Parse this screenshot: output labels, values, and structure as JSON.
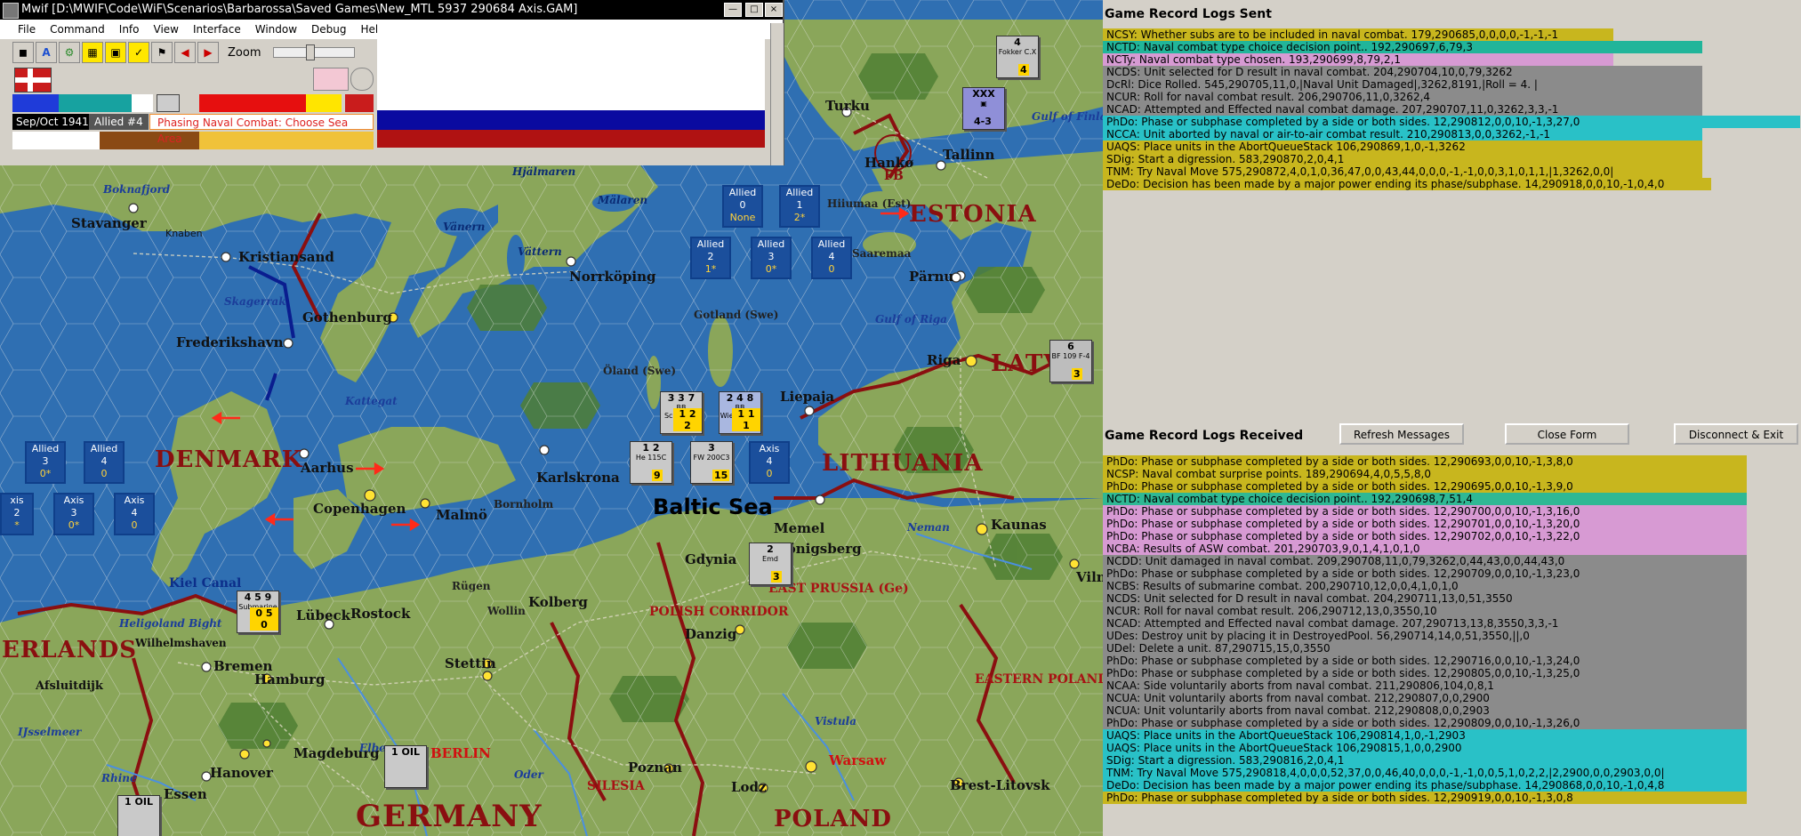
{
  "window": {
    "title": "Mwif [D:\\MWIF\\Code\\WiF\\Scenarios\\Barbarossa\\Saved Games\\New_MTL 5937 290684 Axis.GAM]",
    "menu": [
      "File",
      "Command",
      "Info",
      "View",
      "Interface",
      "Window",
      "Debug",
      "Help"
    ],
    "zoom_label": "Zoom",
    "zoom_value": "4",
    "date": "Sep/Oct 1941",
    "side_turn": "Allied #4",
    "phase": "Phasing Naval Combat: Choose Sea Area"
  },
  "map": {
    "countries": [
      "ESTONIA",
      "DENMARK",
      "LITHUANIA",
      "GERMANY",
      "POLAND",
      "LATV",
      "ERLANDS"
    ],
    "regions": [
      "EAST PRUSSIA (Ge)",
      "POLISH CORRIDOR",
      "EASTERN POLAND",
      "SILESIA"
    ],
    "cities": [
      "Turku",
      "Hankø",
      "Tallinn",
      "Pärnu",
      "Riga",
      "Stavanger",
      "Kristiansand",
      "Gothenburg",
      "Frederikshavn",
      "Aarhus",
      "Copenhagen",
      "Malmö",
      "Karlskrona",
      "Norrköping",
      "Liepaja",
      "Memel",
      "Kaunas",
      "Gdynia",
      "Königsberg",
      "Danzig",
      "Lübeck",
      "Rostock",
      "Kolberg",
      "Stettin",
      "Bremen",
      "Hamburg",
      "Hanover",
      "Magdeburg",
      "BERLIN",
      "Poznan",
      "Lodz",
      "Warsaw",
      "Brest-Litovsk",
      "Essen",
      "Wilhelmshaven",
      "Afsluitdijk",
      "Vilnius",
      "Kiel Canal"
    ],
    "seas": [
      "Boknafjord",
      "Skagerrak",
      "Kattegat",
      "Vänern",
      "Vättern",
      "Mälaren",
      "Hjälmaren",
      "Gotland (Swe)",
      "Öland (Swe)",
      "Bornholm",
      "Rügen",
      "Wollin",
      "Gulf of Riga",
      "Gulf of Finla",
      "Hiiumaa (Est)",
      "Saaremaa",
      "Heligoland Bight",
      "IJsselmeer",
      "Elbe",
      "Oder",
      "Vistula",
      "Neman",
      "Rhine",
      "Knaben"
    ],
    "sea_name": "Baltic Sea",
    "fb_label": "FB",
    "stacks": [
      {
        "side": "Allied",
        "num": "0",
        "val": "None"
      },
      {
        "side": "Allied",
        "num": "1",
        "val": "2*"
      },
      {
        "side": "Allied",
        "num": "2",
        "val": "1*"
      },
      {
        "side": "Allied",
        "num": "3",
        "val": "0*"
      },
      {
        "side": "Allied",
        "num": "4",
        "val": "0"
      },
      {
        "side": "Allied",
        "num": "3",
        "val": "0*"
      },
      {
        "side": "Allied",
        "num": "4",
        "val": "0"
      },
      {
        "side": "Axis",
        "num": "4",
        "val": "0"
      },
      {
        "side": "Axis",
        "num": "3",
        "val": "0*"
      },
      {
        "side": "Axis",
        "num": "4",
        "val": "0"
      },
      {
        "side": "xis",
        "num": "2",
        "val": "*"
      }
    ],
    "units": [
      "BB Schlesien",
      "BB Wiesentien",
      "He 115C",
      "FW 200C3",
      "Submarine",
      "Emd",
      "BF 109 F-4",
      "Fokker C.X",
      "1 OIL",
      "1 OIL"
    ]
  },
  "sent": {
    "title": "Game Record Logs Sent",
    "lines": [
      {
        "text": "NCSY: Whether subs are to be included in naval combat. 179,290685,0,0,0,0,-1,-1,-1",
        "color": "olive"
      },
      {
        "text": "NCTD: Naval combat type choice decision point.. 192,290697,6,79,3",
        "color": "teal"
      },
      {
        "text": "NCTy: Naval combat type chosen. 193,290699,8,79,2,1",
        "color": "pink"
      },
      {
        "text": "NCDS: Unit selected for D result in naval combat. 204,290704,10,0,79,3262",
        "color": "gray"
      },
      {
        "text": "DcRl: Dice Rolled. 545,290705,11,0,|Naval Unit Damaged|,3262,8191,|Roll = 4. |",
        "color": "gray"
      },
      {
        "text": "NCUR: Roll for naval combat result. 206,290706,11,0,3262,4",
        "color": "gray"
      },
      {
        "text": "NCAD: Attempted and Effected naval combat damage. 207,290707,11,0,3262,3,3,-1",
        "color": "gray"
      },
      {
        "text": "PhDo: Phase or subphase completed by a side or both sides. 12,290812,0,0,10,-1,3,27,0",
        "color": "cyan"
      },
      {
        "text": "NCCA: Unit aborted by naval or air-to-air combat result. 210,290813,0,0,3262,-1,-1",
        "color": "cyan"
      },
      {
        "text": "UAQS: Place units in the AbortQueueStack 106,290869,1,0,-1,3262",
        "color": "olive"
      },
      {
        "text": "SDig: Start a digression. 583,290870,2,0,4,1",
        "color": "olive"
      },
      {
        "text": "TNM: Try Naval Move 575,290872,4,0,1,0,36,47,0,0,43,44,0,0,0,-1,-1,0,0,3,1,0,1,1,|1,3262,0,0|",
        "color": "olive"
      },
      {
        "text": "DeDo: Decision has been made by a major power ending its phase/subphase. 14,290918,0,0,10,-1,0,4,0",
        "color": "olive"
      }
    ]
  },
  "received": {
    "title": "Game Record Logs Received",
    "buttons": [
      "Refresh Messages",
      "Close Form",
      "Disconnect & Exit"
    ],
    "lines": [
      {
        "text": "PhDo: Phase or subphase completed by a side or both sides. 12,290693,0,0,10,-1,3,8,0",
        "color": "olive"
      },
      {
        "text": "NCSP: Naval combat surprise points. 189,290694,4,0,5,5,8,0",
        "color": "olive"
      },
      {
        "text": "PhDo: Phase or subphase completed by a side or both sides. 12,290695,0,0,10,-1,3,9,0",
        "color": "olive"
      },
      {
        "text": "NCTD: Naval combat type choice decision point.. 192,290698,7,51,4",
        "color": "tealdark"
      },
      {
        "text": "PhDo: Phase or subphase completed by a side or both sides. 12,290700,0,0,10,-1,3,16,0",
        "color": "pink"
      },
      {
        "text": "PhDo: Phase or subphase completed by a side or both sides. 12,290701,0,0,10,-1,3,20,0",
        "color": "pink"
      },
      {
        "text": "PhDo: Phase or subphase completed by a side or both sides. 12,290702,0,0,10,-1,3,22,0",
        "color": "pink"
      },
      {
        "text": "NCBA: Results of ASW combat. 201,290703,9,0,1,4,1,0,1,0",
        "color": "pink"
      },
      {
        "text": "NCDD: Unit damaged in naval combat. 209,290708,11,0,79,3262,0,44,43,0,0,44,43,0",
        "color": "gray"
      },
      {
        "text": "PhDo: Phase or subphase completed by a side or both sides. 12,290709,0,0,10,-1,3,23,0",
        "color": "gray"
      },
      {
        "text": "NCBS: Results of submarine combat. 200,290710,12,0,0,4,1,0,1,0",
        "color": "gray"
      },
      {
        "text": "NCDS: Unit selected for D result in naval combat. 204,290711,13,0,51,3550",
        "color": "gray"
      },
      {
        "text": "NCUR: Roll for naval combat result. 206,290712,13,0,3550,10",
        "color": "gray"
      },
      {
        "text": "NCAD: Attempted and Effected naval combat damage. 207,290713,13,8,3550,3,3,-1",
        "color": "gray"
      },
      {
        "text": "UDes: Destroy unit by placing it in DestroyedPool. 56,290714,14,0,51,3550,||,0",
        "color": "gray"
      },
      {
        "text": "UDel: Delete a unit. 87,290715,15,0,3550",
        "color": "gray"
      },
      {
        "text": "PhDo: Phase or subphase completed by a side or both sides. 12,290716,0,0,10,-1,3,24,0",
        "color": "gray"
      },
      {
        "text": "PhDo: Phase or subphase completed by a side or both sides. 12,290805,0,0,10,-1,3,25,0",
        "color": "gray"
      },
      {
        "text": "NCAA: Side voluntarily aborts from naval combat. 211,290806,104,0,8,1",
        "color": "gray"
      },
      {
        "text": "NCUA: Unit voluntarily aborts from naval combat. 212,290807,0,0,2900",
        "color": "gray"
      },
      {
        "text": "NCUA: Unit voluntarily aborts from naval combat. 212,290808,0,0,2903",
        "color": "gray"
      },
      {
        "text": "PhDo: Phase or subphase completed by a side or both sides. 12,290809,0,0,10,-1,3,26,0",
        "color": "gray"
      },
      {
        "text": "UAQS: Place units in the AbortQueueStack 106,290814,1,0,-1,2903",
        "color": "cyan"
      },
      {
        "text": "UAQS: Place units in the AbortQueueStack 106,290815,1,0,0,2900",
        "color": "cyan"
      },
      {
        "text": "SDig: Start a digression. 583,290816,2,0,4,1",
        "color": "cyan"
      },
      {
        "text": "TNM: Try Naval Move 575,290818,4,0,0,0,52,37,0,0,46,40,0,0,0,-1,-1,0,0,5,1,0,2,2,|2,2900,0,0,2903,0,0|",
        "color": "cyan"
      },
      {
        "text": "DeDo: Decision has been made by a major power ending its phase/subphase. 14,290868,0,0,10,-1,0,4,8",
        "color": "cyan"
      },
      {
        "text": "PhDo: Phase or subphase completed by a side or both sides. 12,290919,0,0,10,-1,3,0,8",
        "color": "olive"
      }
    ]
  }
}
